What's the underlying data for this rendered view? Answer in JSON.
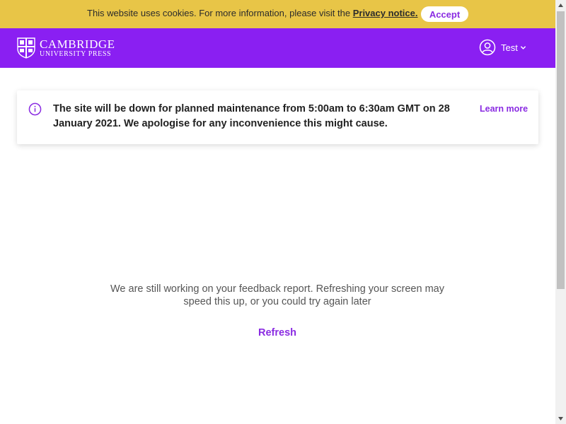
{
  "cookie_bar": {
    "text": "This website uses cookies. For more information, please visit the ",
    "link": "Privacy notice.",
    "accept_label": "Accept"
  },
  "header": {
    "logo_line1": "CAMBRIDGE",
    "logo_line2": "UNIVERSITY PRESS",
    "user_label": "Test"
  },
  "notice": {
    "text": "The site will be down for planned maintenance from 5:00am to 6:30am GMT on 28 January 2021. We apologise for any inconvenience this might cause.",
    "learn_more": "Learn more",
    "icon": "info-icon"
  },
  "main": {
    "message": "We are still working on your feedback report. Refreshing your screen may speed this up, or you could try again later",
    "refresh_label": "Refresh"
  },
  "colors": {
    "brand_purple": "#8a1ff2",
    "accent_purple": "#8a2be2",
    "cookie_yellow": "#e8c547"
  }
}
